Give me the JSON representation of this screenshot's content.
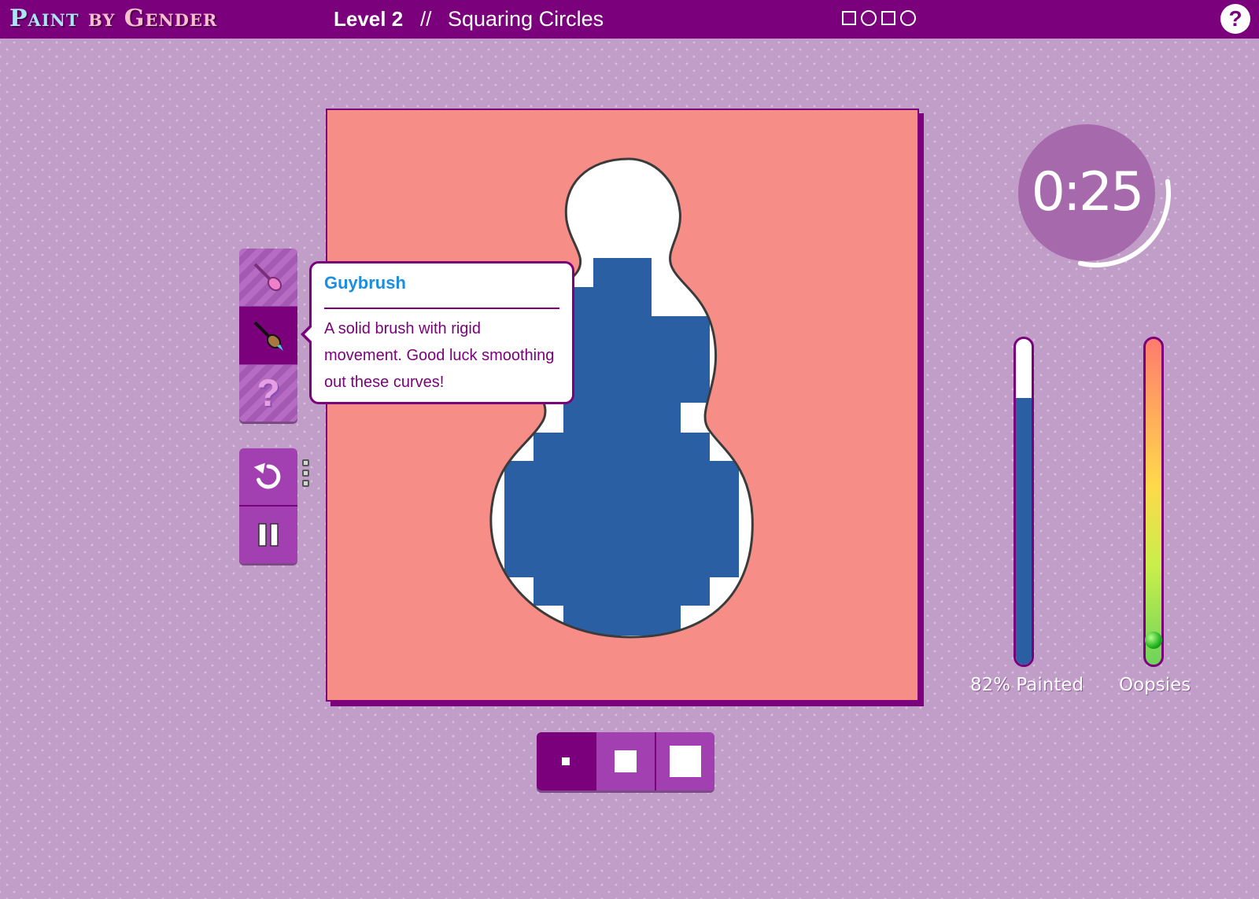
{
  "app": {
    "title_word1": "Paint",
    "title_word2": "by",
    "title_word3": "Gender"
  },
  "level": {
    "number_label": "Level 2",
    "separator": "//",
    "name": "Squaring Circles"
  },
  "level_progress_icons": [
    "square-icon",
    "circle-icon",
    "square-icon",
    "circle-icon"
  ],
  "help": {
    "label": "?"
  },
  "tools": [
    {
      "name": "gal-brush",
      "icon": "brush-icon",
      "selected": false
    },
    {
      "name": "guybrush",
      "icon": "brush-icon",
      "selected": true
    },
    {
      "name": "mystery",
      "icon": "question-icon",
      "label": "?",
      "selected": false
    }
  ],
  "tooltip": {
    "title": "Guybrush",
    "body": "A solid brush with rigid movement. Good luck smoothing out these curves!"
  },
  "controls": {
    "undo_icon": "undo-icon",
    "pause_icon": "pause-icon",
    "undo_slots": 3
  },
  "brush_sizes": [
    {
      "name": "small",
      "selected": true
    },
    {
      "name": "medium",
      "selected": false
    },
    {
      "name": "large",
      "selected": false
    }
  ],
  "timer": {
    "value": "0:25",
    "remaining_fraction": 0.5
  },
  "meters": {
    "painted_label": "82% Painted",
    "painted_fraction": 0.82,
    "oopsies_label": "Oopsies",
    "oopsies_fraction": 0.04
  },
  "colors": {
    "brand_purple": "#7b007b",
    "background": "#c19ec7",
    "canvas_pink": "#f68d87",
    "paint_blue": "#2b5fa3",
    "tooltip_title_blue": "#1a8ee0"
  }
}
